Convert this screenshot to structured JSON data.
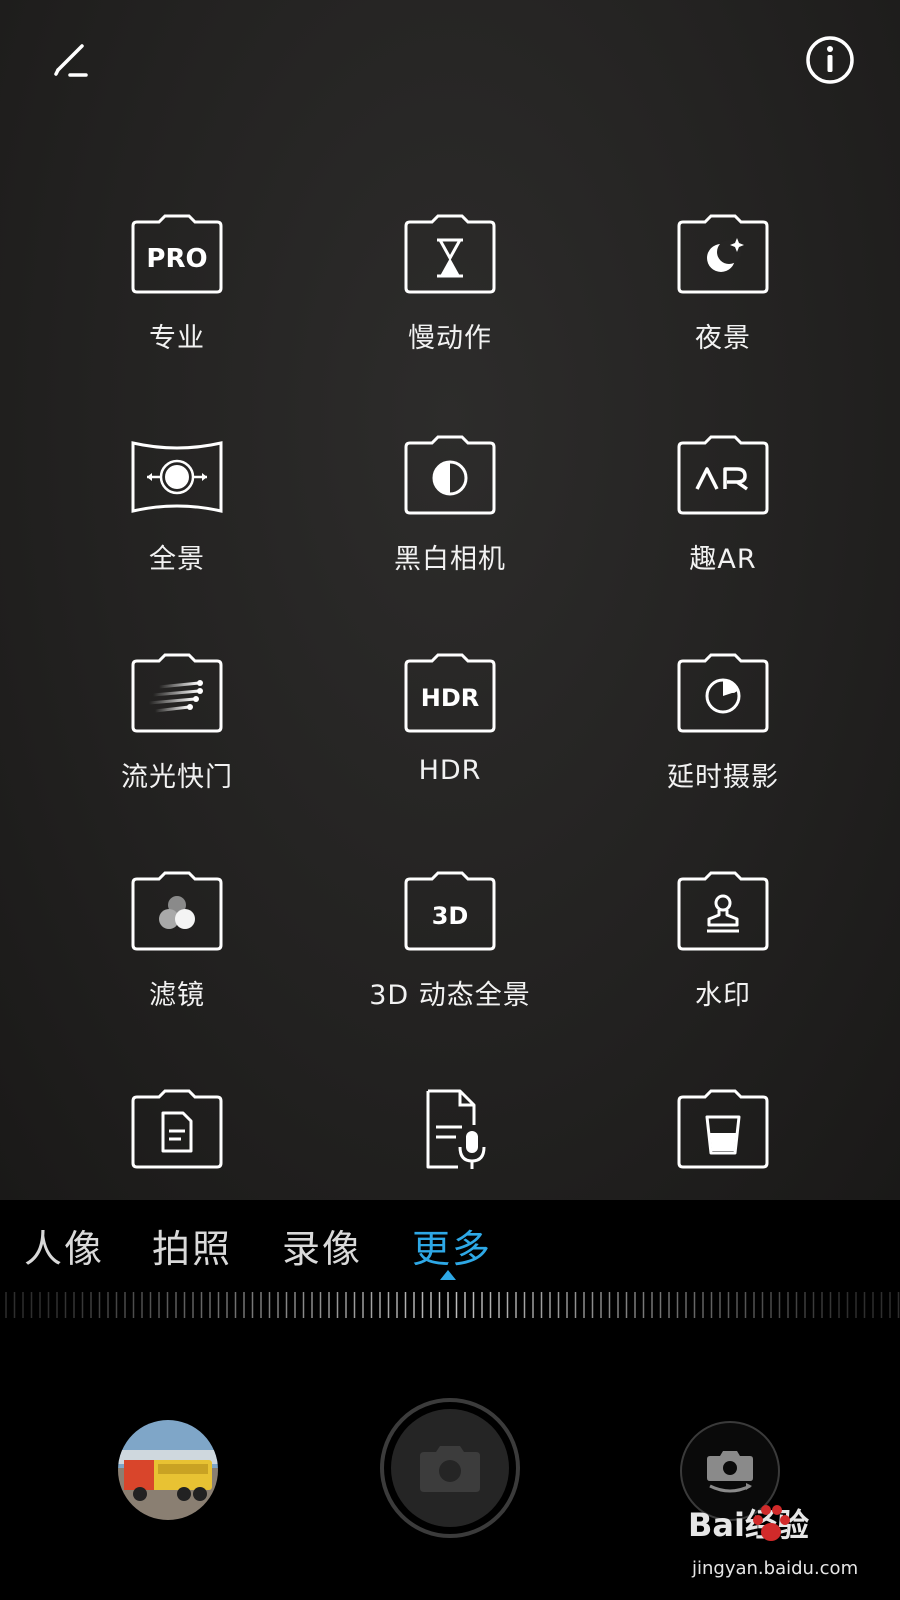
{
  "top_bar": {
    "edit_icon": "edit-icon",
    "info_icon": "info-icon"
  },
  "modes": [
    {
      "label": "专业",
      "icon": "pro-icon",
      "icon_text": "PRO"
    },
    {
      "label": "慢动作",
      "icon": "slow-motion-icon"
    },
    {
      "label": "夜景",
      "icon": "night-icon"
    },
    {
      "label": "全景",
      "icon": "panorama-icon"
    },
    {
      "label": "黑白相机",
      "icon": "monochrome-icon"
    },
    {
      "label": "趣AR",
      "icon": "ar-icon",
      "icon_text": "AR"
    },
    {
      "label": "流光快门",
      "icon": "light-painting-icon"
    },
    {
      "label": "HDR",
      "icon": "hdr-icon",
      "icon_text": "HDR"
    },
    {
      "label": "延时摄影",
      "icon": "time-lapse-icon"
    },
    {
      "label": "滤镜",
      "icon": "filter-icon"
    },
    {
      "label": "3D 动态全景",
      "icon": "3d-panorama-icon",
      "icon_text": "3D"
    },
    {
      "label": "水印",
      "icon": "watermark-icon"
    },
    {
      "label": "",
      "icon": "document-scan-icon"
    },
    {
      "label": "",
      "icon": "voice-note-icon"
    },
    {
      "label": "",
      "icon": "cup-icon"
    }
  ],
  "tabs": [
    {
      "label": "人像",
      "active": false
    },
    {
      "label": "拍照",
      "active": false
    },
    {
      "label": "录像",
      "active": false
    },
    {
      "label": "更多",
      "active": true
    }
  ],
  "colors": {
    "accent": "#2ea8e6",
    "background": "#1f1e1d"
  },
  "controls": {
    "gallery_thumbnail": "gallery-thumbnail",
    "shutter_icon": "camera-icon",
    "switch_camera_icon": "switch-camera-icon"
  },
  "watermark": {
    "brand": "Bai经验",
    "url": "jingyan.baidu.com"
  }
}
